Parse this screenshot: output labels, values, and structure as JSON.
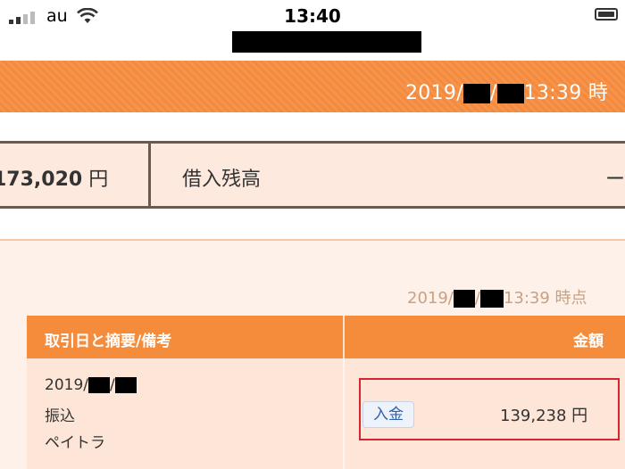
{
  "status_bar": {
    "carrier": "au",
    "time": "13:40"
  },
  "header": {
    "timestamp_year": "2019/",
    "timestamp_sep": "/",
    "timestamp_time": "13:39 時"
  },
  "summary": {
    "amount_value": "173,020",
    "amount_unit": "円",
    "loan_label": "借入残高",
    "loan_value": "ー"
  },
  "panel": {
    "timestamp_year": "2019/",
    "timestamp_sep": "/",
    "timestamp_time": "13:39 時点"
  },
  "table": {
    "columns": [
      "取引日と摘要/備考",
      "金額"
    ],
    "rows": [
      {
        "date_year": "2019/",
        "date_sep": "/",
        "type": "振込",
        "description": "ペイトラ",
        "badge": "入金",
        "amount": "139,238 円"
      }
    ]
  },
  "colors": {
    "accent": "#f58c3c",
    "highlight": "#d9232d",
    "badge_text": "#2d62b2"
  }
}
